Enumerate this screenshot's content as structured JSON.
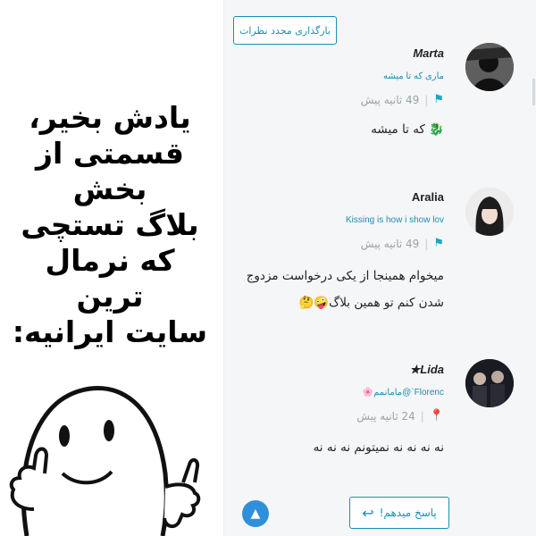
{
  "caption": "یادش بخیر،\nقسمتی از\nبخش\nبلاگ تستچی\nکه نرمال ترین\nسایت ایرانیه:",
  "feed": {
    "reload_label": "بارگذاری مجدد نظرات",
    "reply_label": "پاسخ میدهم!",
    "comments": [
      {
        "username": "Marta",
        "bio": "ماری که تا میشه",
        "time": "49 ثانیه پیش",
        "body": "🐉 که تا میشه"
      },
      {
        "username": "Aralia",
        "bio": "Kissing is how i show lov",
        "time": "49 ثانیه پیش",
        "body": "میخوام همینجا از یکی درخواست مزدوج شدن کنم تو همین بلاگ🤪🤔"
      },
      {
        "username": "★Lida",
        "bio": "🌸مامانمم@`Florenc",
        "time": "24 ثانیه پیش",
        "body": "نه نه نه نه نمیتونم نه نه نه"
      }
    ]
  },
  "icons": {
    "flag": "flag-icon",
    "pin": "pin-icon",
    "reply": "reply-arrow-icon",
    "scroll_top": "chevron-up-icon"
  },
  "colors": {
    "accent": "#1a8fb3",
    "meta_icon": "#1aa7c8",
    "scroll_top": "#2f8fd8",
    "feed_bg": "#f5f6f7"
  }
}
